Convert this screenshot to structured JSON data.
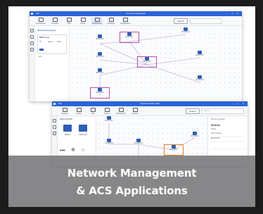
{
  "screen_back": {
    "title": "Provision Node pack",
    "menu": "File",
    "ribbon": [
      "Provisioning",
      "Provision",
      "ACS",
      "Route",
      "Provisioning",
      "Configure",
      "Configuration"
    ],
    "search_button": "Search",
    "panel_heading": "Node Provisioning (3)",
    "panel_lines": [
      "MMP Group",
      "ID",
      "Status",
      "Value",
      "Add"
    ],
    "devices": [
      "ZC 10.12.1",
      "ZC 10.12.2",
      "ZC 10.12.3",
      "ZC 10.12.4",
      "ZC 10.12.5",
      "ZC 10.12.6",
      "ZC 10.12.7",
      "ZC 10.12.8",
      "ZC 10.12.9"
    ]
  },
  "screen_front": {
    "title": "Provision Node pack",
    "menu": "File",
    "ribbon": [
      "Network",
      "Create",
      "ACS",
      "Access",
      "Provisioning",
      "Ungroup"
    ],
    "search_button": "Search",
    "search_placeholder": "Search...",
    "panel_heading": "Search Results",
    "palette": [
      {
        "label": "Switch"
      },
      {
        "label": "Network"
      }
    ],
    "right_panel_heading": "Device Properties",
    "right_panel_lines": [
      "Devices",
      "Status",
      "Device Name",
      "ZC 10.12.3"
    ],
    "devices": [
      "ZC 10.12.1",
      "ZC 10.12.2",
      "ZC 10.12.3",
      "ZC 10.12.4",
      "ZC 10.12.5"
    ]
  },
  "banner": {
    "line1": "Network Management",
    "line2": "& ACS Applications"
  },
  "colors": {
    "titlebar": "#2b64d6",
    "device": "#2f5fb3",
    "selection_purple": "#b44fb0",
    "selection_orange": "#d9822b",
    "banner": "#707074"
  }
}
